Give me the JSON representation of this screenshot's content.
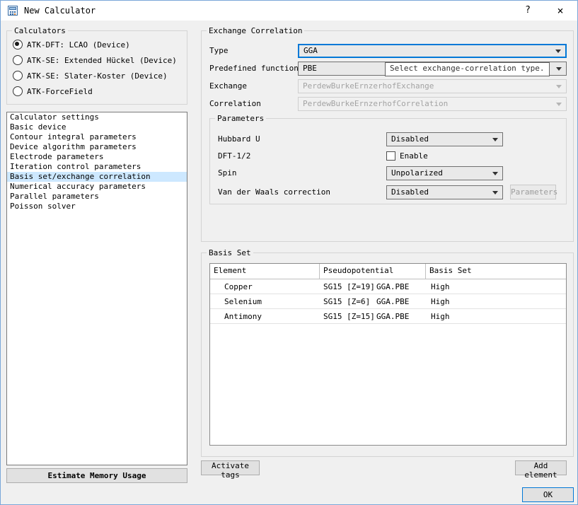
{
  "window": {
    "title": "New Calculator",
    "help_label": "?",
    "close_label": "×"
  },
  "calculators": {
    "group_label": "Calculators",
    "options": [
      {
        "label": "ATK-DFT: LCAO (Device)",
        "selected": true
      },
      {
        "label": "ATK-SE: Extended Hückel (Device)",
        "selected": false
      },
      {
        "label": "ATK-SE: Slater-Koster (Device)",
        "selected": false
      },
      {
        "label": "ATK-ForceField",
        "selected": false
      }
    ]
  },
  "settings_list": {
    "header": "Calculator settings",
    "items": [
      "Basic device",
      "Contour integral parameters",
      "Device algorithm parameters",
      "Electrode parameters",
      "Iteration control parameters",
      "Basis set/exchange correlation",
      "Numerical accuracy parameters",
      "Parallel parameters",
      "Poisson solver"
    ],
    "selected_item": "Basis set/exchange correlation"
  },
  "buttons": {
    "estimate": "Estimate Memory Usage",
    "ok": "OK"
  },
  "exchange_correlation": {
    "group_label": "Exchange Correlation",
    "type_label": "Type",
    "type_value": "GGA",
    "predefined_label": "Predefined functionals",
    "predefined_value": "PBE",
    "tooltip": "Select exchange-correlation type.",
    "exchange_label": "Exchange",
    "exchange_value": "PerdewBurkeErnzerhofExchange",
    "correlation_label": "Correlation",
    "correlation_value": "PerdewBurkeErnzerhofCorrelation",
    "parameters": {
      "group_label": "Parameters",
      "hubbard_label": "Hubbard U",
      "hubbard_value": "Disabled",
      "dft_half_label": "DFT-1/2",
      "dft_half_checkbox_label": "Enable",
      "dft_half_checked": false,
      "spin_label": "Spin",
      "spin_value": "Unpolarized",
      "vdw_label": "Van der Waals correction",
      "vdw_value": "Disabled",
      "vdw_parameters_label": "Parameters"
    }
  },
  "basis_set": {
    "group_label": "Basis Set",
    "activate_tags_label": "Activate tags",
    "add_element_label": "Add element",
    "table": {
      "headers": [
        "Element",
        "Pseudopotential",
        "Basis Set"
      ],
      "rows": [
        {
          "element": "Copper",
          "pseudopotential": "SG15 [Z=19]",
          "functional": "GGA.PBE",
          "basis": "High"
        },
        {
          "element": "Selenium",
          "pseudopotential": "SG15 [Z=6]",
          "functional": "GGA.PBE",
          "basis": "High"
        },
        {
          "element": "Antimony",
          "pseudopotential": "SG15 [Z=15]",
          "functional": "GGA.PBE",
          "basis": "High"
        }
      ]
    }
  },
  "colors": {
    "accent": "#0078d7",
    "selection": "#cde8ff",
    "window_bg": "#f0f0f0"
  }
}
